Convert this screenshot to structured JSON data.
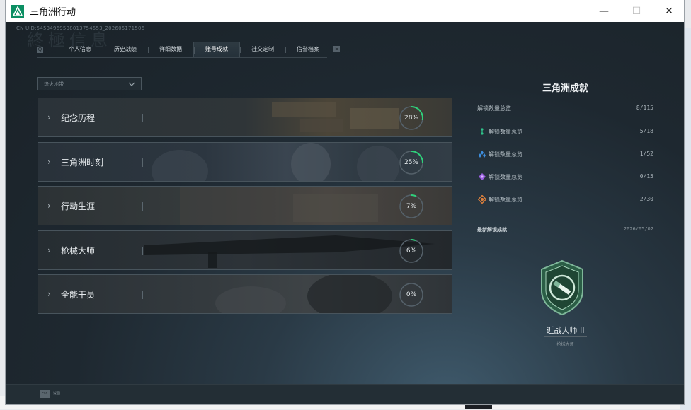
{
  "window": {
    "title": "三角洲行动",
    "controls": {
      "minimize": "—",
      "maximize": "☐",
      "close": "✕"
    }
  },
  "uid_text": "CN UID:545349695380137545​53_202605171506",
  "watermark": "終極信息",
  "tabs": [
    {
      "label": "个人信息",
      "active": false
    },
    {
      "label": "历史战绩",
      "active": false
    },
    {
      "label": "详细数据",
      "active": false
    },
    {
      "label": "账号成就",
      "active": true
    },
    {
      "label": "社交定制",
      "active": false
    },
    {
      "label": "信誉档案",
      "active": false
    }
  ],
  "tab_arrows": {
    "left": "Q",
    "right": "E"
  },
  "dropdown": {
    "value": "烽火地带"
  },
  "achievements": [
    {
      "label": "纪念历程",
      "percent_text": "28%",
      "progress": 0.28
    },
    {
      "label": "三角洲时刻",
      "percent_text": "25%",
      "progress": 0.25
    },
    {
      "label": "行动生涯",
      "percent_text": "7%",
      "progress": 0.07
    },
    {
      "label": "枪械大师",
      "percent_text": "6%",
      "progress": 0.06
    },
    {
      "label": "全能干员",
      "percent_text": "0%",
      "progress": 0.0
    }
  ],
  "panel": {
    "title": "三角洲成就",
    "total": {
      "label": "解锁数量总览",
      "value": "8/115"
    },
    "tiers": [
      {
        "label": "解锁数量总览",
        "value": "5/18",
        "icon": "green-tier-icon",
        "color": "#2fc38a"
      },
      {
        "label": "解锁数量总览",
        "value": "1/52",
        "icon": "blue-tier-icon",
        "color": "#3d8fe0"
      },
      {
        "label": "解锁数量总览",
        "value": "0/15",
        "icon": "purple-tier-icon",
        "color": "#9a5fe0"
      },
      {
        "label": "解锁数量总览",
        "value": "2/30",
        "icon": "orange-tier-icon",
        "color": "#e0823d"
      }
    ],
    "recent_label": "最新解锁成就",
    "recent_date": "2026/05/02",
    "medal_name": "近战大师 II",
    "medal_category": "枪械大师"
  },
  "bottombar": {
    "esc_key": "Esc",
    "esc_label": "返回"
  },
  "colors": {
    "accent": "#2fd07b",
    "ring_track": "#55616a"
  }
}
